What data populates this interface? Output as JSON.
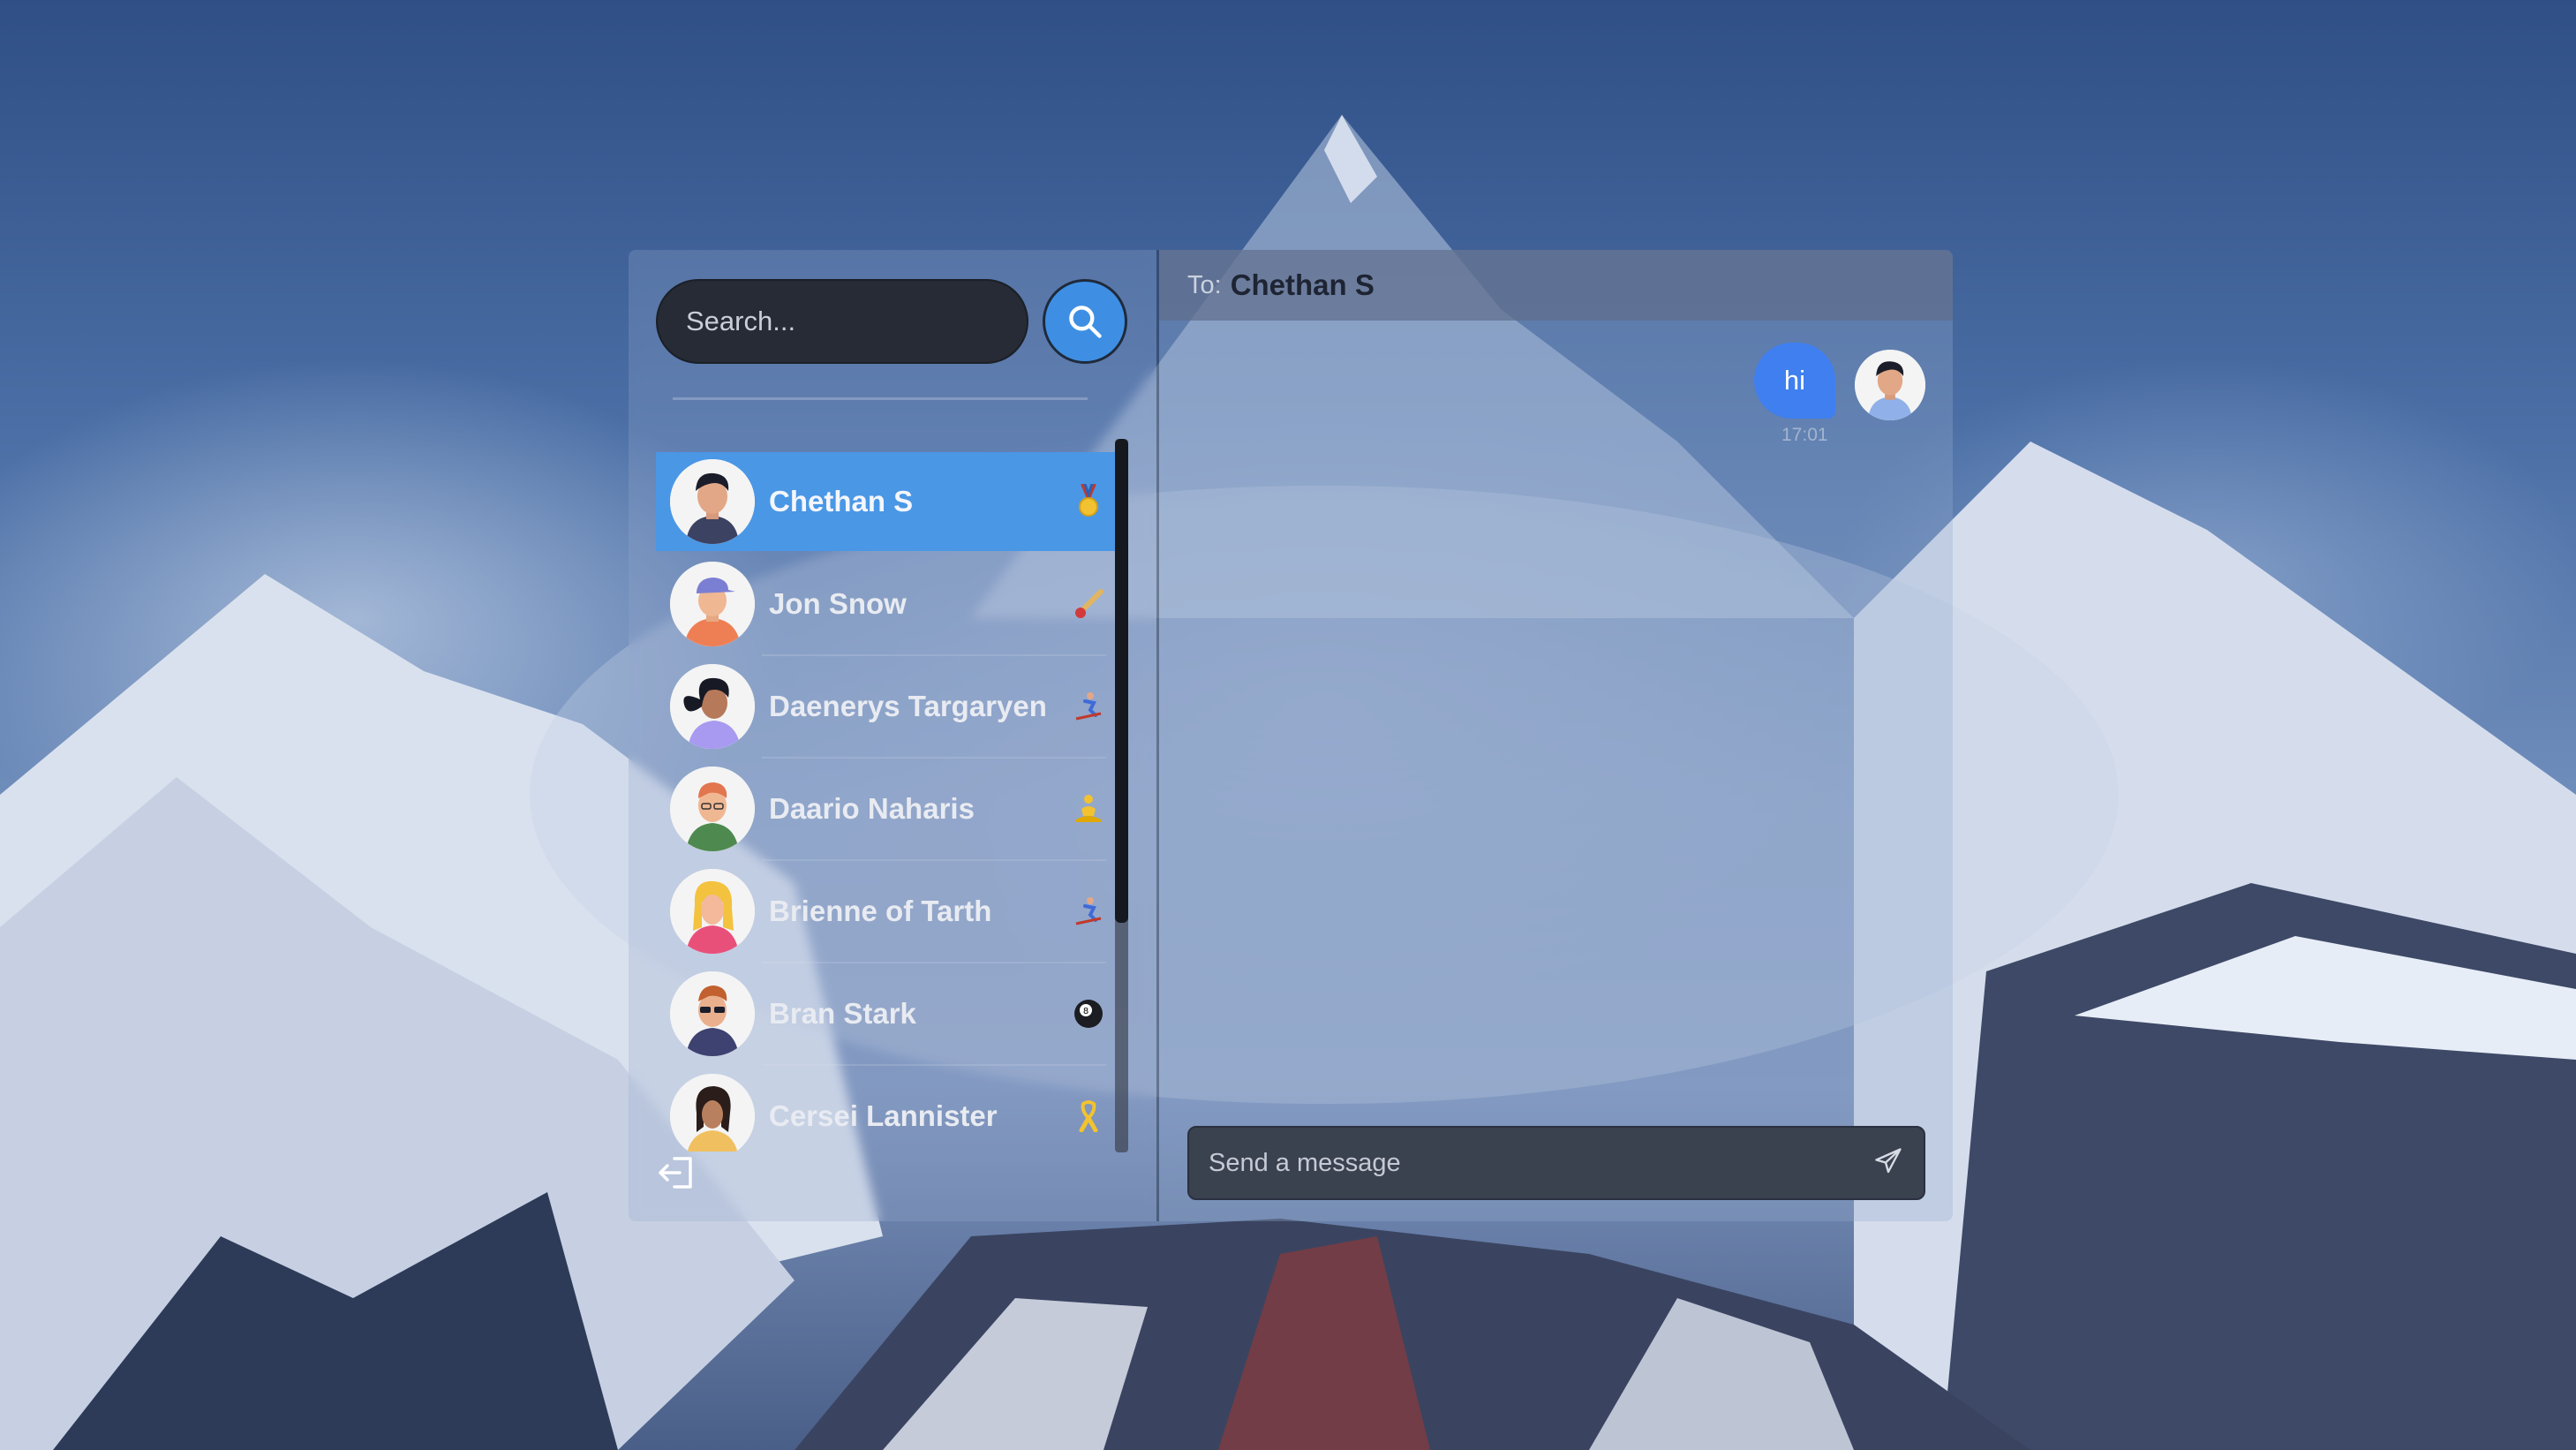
{
  "search": {
    "placeholder": "Search...",
    "button_icon": "search-icon"
  },
  "contacts": [
    {
      "name": "Chethan S",
      "emoji": "medal",
      "active": true
    },
    {
      "name": "Jon Snow",
      "emoji": "cricket",
      "active": false
    },
    {
      "name": "Daenerys Targaryen",
      "emoji": "skier",
      "active": false
    },
    {
      "name": "Daario Naharis",
      "emoji": "meditation",
      "active": false
    },
    {
      "name": "Brienne of Tarth",
      "emoji": "skier",
      "active": false
    },
    {
      "name": "Bran Stark",
      "emoji": "8-ball",
      "active": false
    },
    {
      "name": "Cersei Lannister",
      "emoji": "ribbon",
      "active": false
    }
  ],
  "chat": {
    "to_label": "To:",
    "recipient": "Chethan S",
    "messages": [
      {
        "text": "hi",
        "time": "17:01",
        "from_me": true
      }
    ],
    "input_placeholder": "Send a message"
  },
  "icons": {
    "logout": "logout-icon",
    "send": "send-icon"
  },
  "colors": {
    "accent": "#4a97e6",
    "bubble": "#3f7ff0",
    "search_bg": "#262b35"
  }
}
